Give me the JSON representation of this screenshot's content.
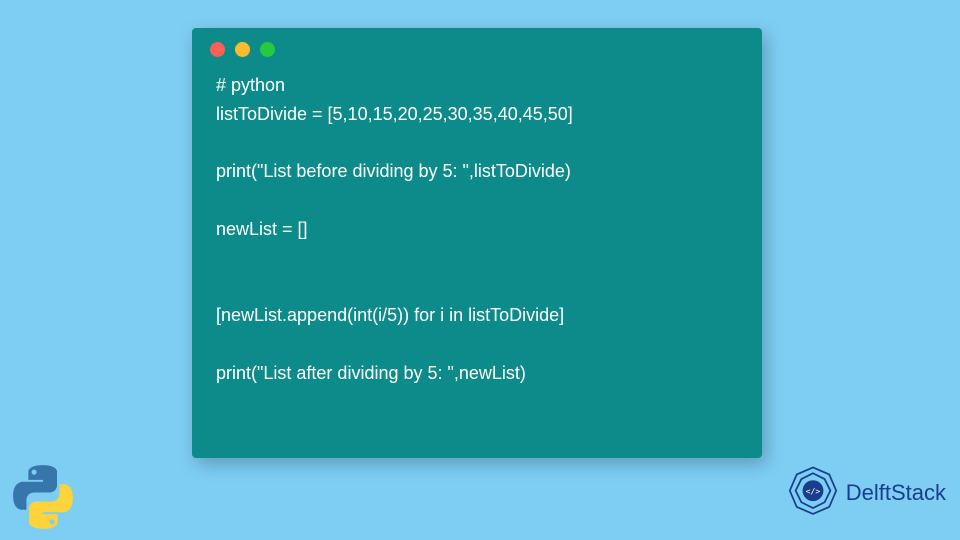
{
  "code": {
    "lines": [
      "# python",
      "listToDivide = [5,10,15,20,25,30,35,40,45,50]",
      "",
      "print(\"List before dividing by 5: \",listToDivide)",
      "",
      "newList = []",
      "",
      "",
      "[newList.append(int(i/5)) for i in listToDivide]",
      "",
      "print(\"List after dividing by 5: \",newList)"
    ]
  },
  "traffic_lights": {
    "red": "#ff5f56",
    "yellow": "#ffbd2e",
    "green": "#27c93f"
  },
  "branding": {
    "label": "DelftStack"
  },
  "colors": {
    "background": "#7ecef4",
    "window": "#0d8b8b",
    "text": "#ffffff",
    "brand": "#1a3e8c"
  }
}
